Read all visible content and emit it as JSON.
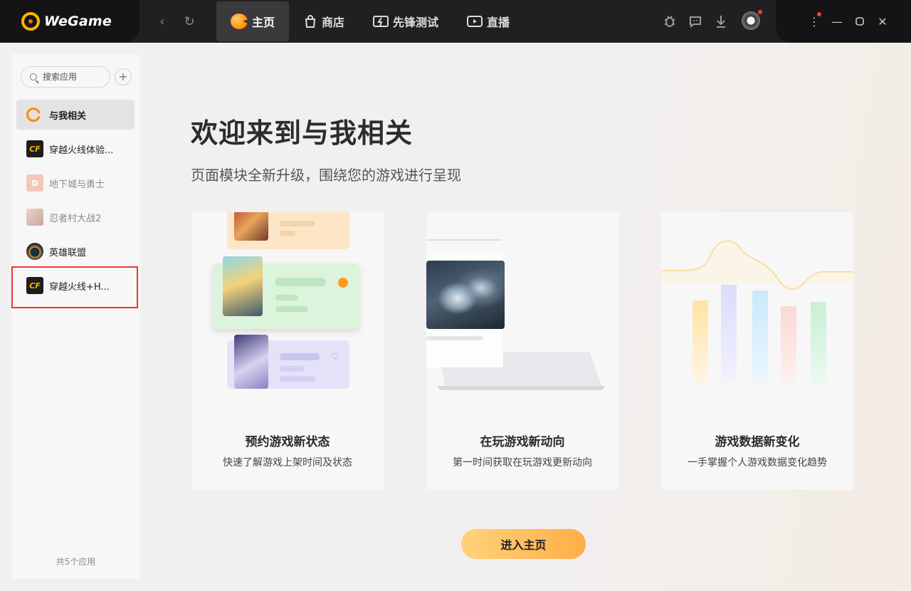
{
  "app": {
    "logo_text": "WeGame"
  },
  "tabs": [
    {
      "label": "主页",
      "active": true
    },
    {
      "label": "商店"
    },
    {
      "label": "先锋测试"
    },
    {
      "label": "直播"
    }
  ],
  "sidebar": {
    "search_placeholder": "搜索应用",
    "items": [
      {
        "label": "与我相关",
        "active": true
      },
      {
        "label": "穿越火线体验..."
      },
      {
        "label": "地下城与勇士",
        "dim": true
      },
      {
        "label": "忍者村大战2",
        "dim": true
      },
      {
        "label": "英雄联盟"
      },
      {
        "label": "穿越火线+H..."
      }
    ],
    "footer": "共5个应用"
  },
  "hero": {
    "title": "欢迎来到与我相关",
    "subtitle": "页面模块全新升级，围绕您的游戏进行呈现"
  },
  "cards": [
    {
      "title": "预约游戏新状态",
      "desc": "快速了解游戏上架时间及状态"
    },
    {
      "title": "在玩游戏新动向",
      "desc": "第一时间获取在玩游戏更新动向"
    },
    {
      "title": "游戏数据新变化",
      "desc": "一手掌握个人游戏数据变化趋势"
    }
  ],
  "cta": {
    "label": "进入主页"
  },
  "colors": {
    "topbar": "#202022",
    "accent_orange": "#ffae48",
    "selection_red": "#e53935"
  }
}
